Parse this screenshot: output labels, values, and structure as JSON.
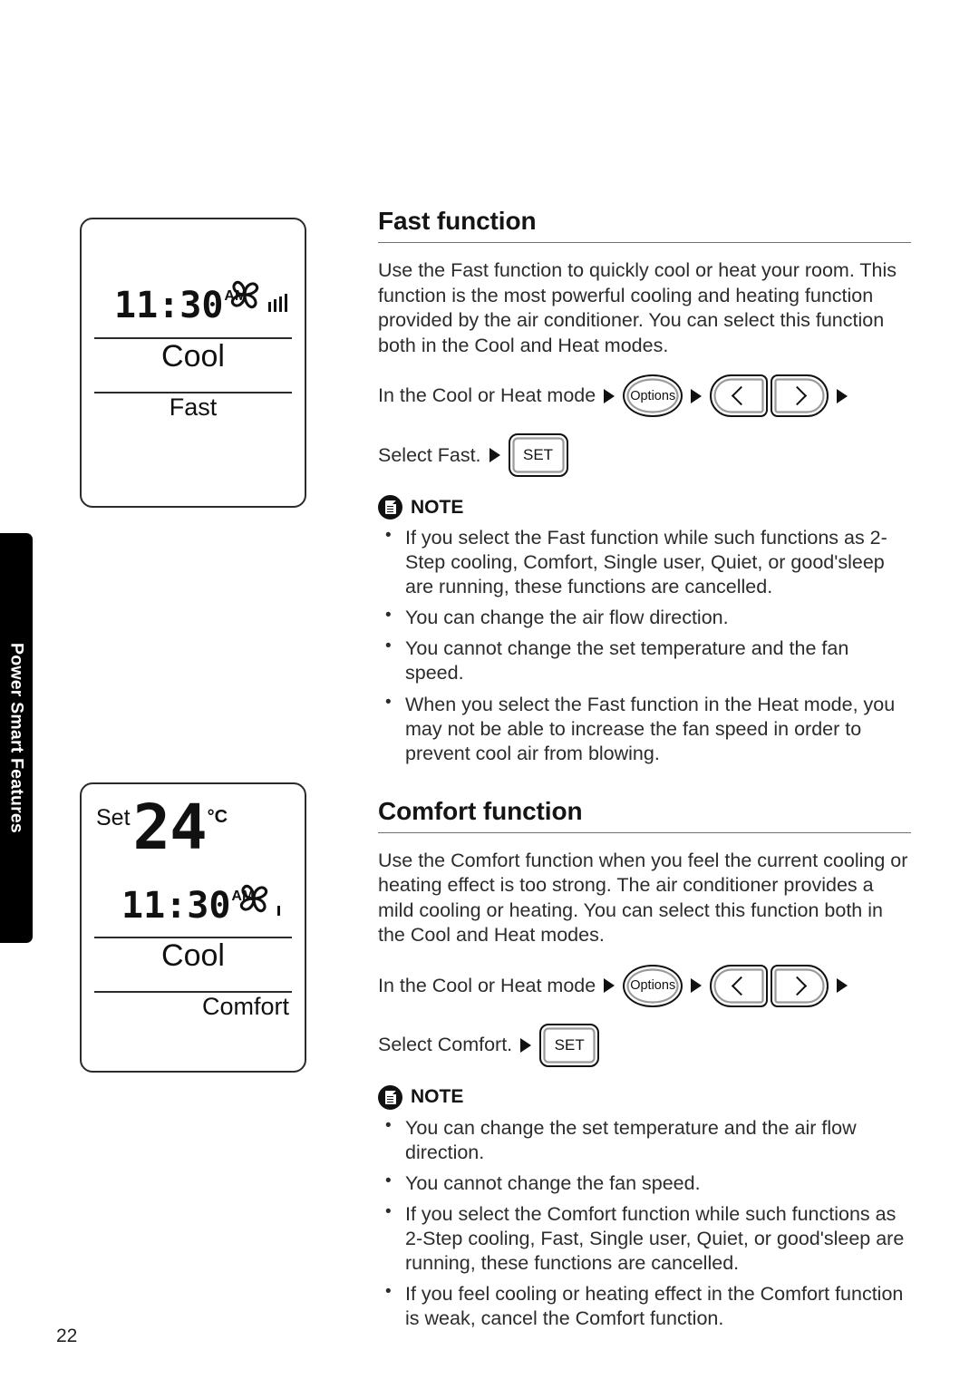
{
  "page": {
    "number": "22",
    "side_tab_label": "Power Smart Features"
  },
  "displays": [
    {
      "name": "fast-display",
      "set_label": "",
      "set_temp": "",
      "set_unit": "",
      "time": "11:30",
      "ampm": "AM",
      "fan_icon": "fan-pinwheel-icon",
      "fan_bars": 4,
      "mode": "Cool",
      "function": "Fast"
    },
    {
      "name": "comfort-display",
      "set_label": "Set",
      "set_temp": "24",
      "set_unit": "°C",
      "time": "11:30",
      "ampm": "AM",
      "fan_icon": "fan-pinwheel-icon",
      "fan_bars": 1,
      "mode": "Cool",
      "function": "Comfort"
    }
  ],
  "sections": [
    {
      "title": "Fast function",
      "body": "Use the Fast function to quickly cool or heat your room. This function is the most powerful cooling and heating function provided by the air conditioner. You can select this function both in the Cool and Heat modes.",
      "steps": {
        "line1_text": "In the Cool or Heat mode",
        "options_label": "Options",
        "left_arrow_icon": "chevron-left-icon",
        "right_arrow_icon": "chevron-right-icon",
        "line2_text": "Select Fast.",
        "set_label": "SET"
      },
      "note": {
        "icon": "note-document-icon",
        "label": "NOTE",
        "items": [
          "If you select the Fast function while such functions as 2-Step cooling, Comfort, Single user, Quiet, or good'sleep are running, these functions are cancelled.",
          "You can change the air flow direction.",
          "You cannot change the set temperature and the fan speed.",
          "When you select the Fast function in the Heat mode, you may not be able to increase the fan speed in order to prevent cool air from blowing."
        ]
      }
    },
    {
      "title": "Comfort function",
      "body": "Use the Comfort function when you feel the current cooling or heating effect is too strong. The air conditioner provides a mild cooling or heating. You can select this function both in the Cool and Heat modes.",
      "steps": {
        "line1_text": "In the Cool or Heat mode",
        "options_label": "Options",
        "left_arrow_icon": "chevron-left-icon",
        "right_arrow_icon": "chevron-right-icon",
        "line2_text": "Select Comfort.",
        "set_label": "SET"
      },
      "note": {
        "icon": "note-document-icon",
        "label": "NOTE",
        "items": [
          "You can change the set temperature and the air flow direction.",
          "You cannot change the fan speed.",
          "If you select the Comfort function while such functions as 2-Step cooling, Fast, Single user, Quiet, or good'sleep are running, these functions are cancelled.",
          "If you feel cooling or heating effect in the Comfort function is weak, cancel the Comfort function."
        ]
      }
    }
  ],
  "colors": {
    "text": "#2c2c2c",
    "heading": "#141414",
    "rule": "#6f6f6f",
    "tab_bg": "#000000",
    "tab_text": "#ffffff"
  }
}
